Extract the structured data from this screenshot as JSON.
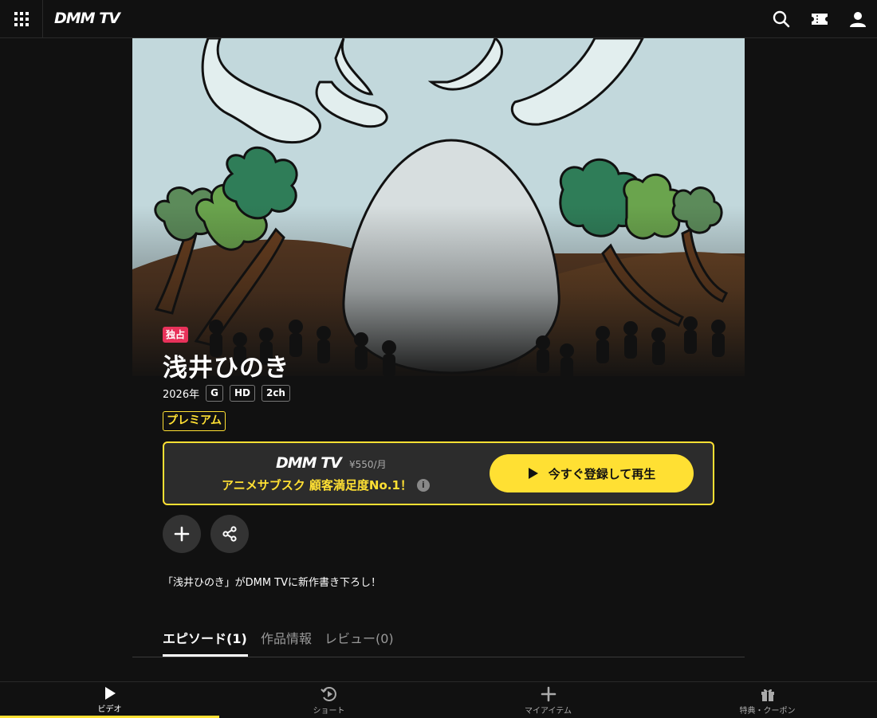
{
  "header": {
    "logo": "DMM TV"
  },
  "hero": {
    "badge": "独占",
    "title": "浅井ひのき"
  },
  "meta": {
    "year": "2026年",
    "tags": [
      "G",
      "HD",
      "2ch"
    ]
  },
  "premium_label": "プレミアム",
  "subscription": {
    "logo": "DMM TV",
    "price": "¥550/月",
    "catch": "アニメサブスク 顧客満足度No.1！",
    "info_icon": "i",
    "play_button": "今すぐ登録して再生"
  },
  "description": "「浅井ひのき」がDMM TVに新作書き下ろし！",
  "tabs": [
    {
      "label": "エピソード(1)",
      "active": true
    },
    {
      "label": "作品情報",
      "active": false
    },
    {
      "label": "レビュー(0)",
      "active": false
    }
  ],
  "bottom_nav": [
    {
      "label": "ビデオ",
      "icon": "play-icon",
      "active": true
    },
    {
      "label": "ショート",
      "icon": "short-play-icon",
      "active": false
    },
    {
      "label": "マイアイテム",
      "icon": "plus-icon",
      "active": false
    },
    {
      "label": "特典・クーポン",
      "icon": "gift-icon",
      "active": false
    }
  ],
  "colors": {
    "accent": "#ffe033",
    "exclusive_badge": "#e8325a",
    "background": "#111111"
  }
}
